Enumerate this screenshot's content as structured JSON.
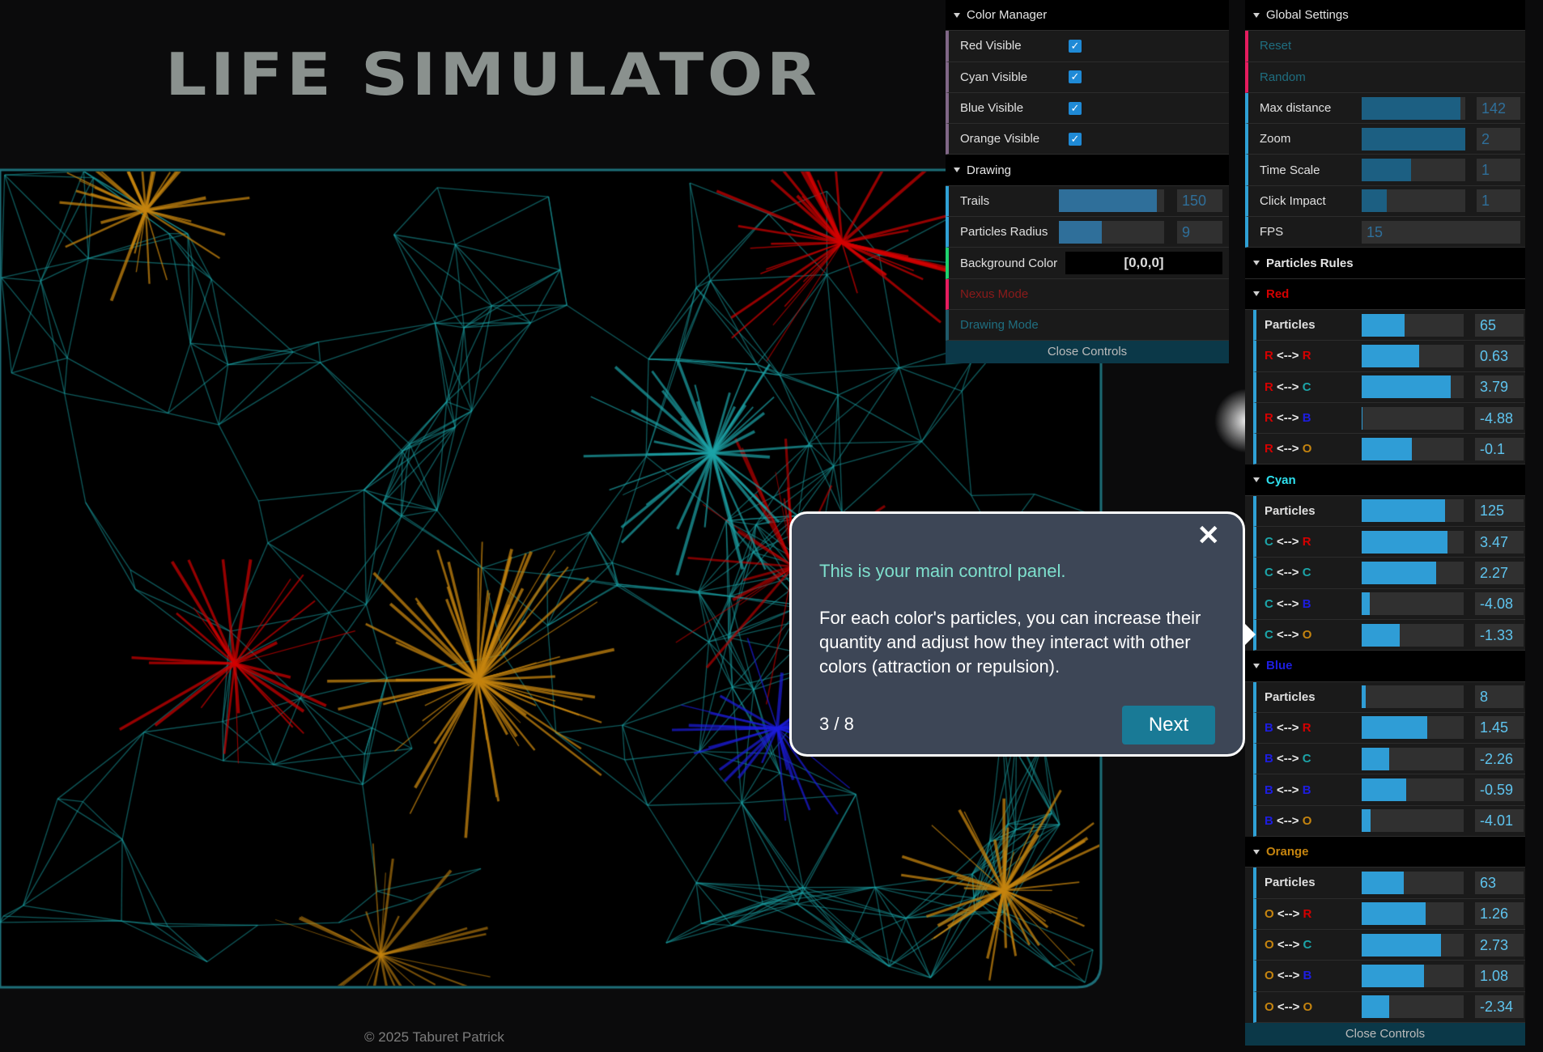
{
  "app": {
    "title": "LIFE SIMULATOR",
    "footer": "© 2025 Taburet Patrick"
  },
  "colors": {
    "red": "#d40000",
    "cyan": "#1ca4a8",
    "blue": "#1d1de0",
    "orange": "#c5840f",
    "slider": "#2f9dd6",
    "accent_teal": "#197a96"
  },
  "color_manager": {
    "title": "Color Manager",
    "items": [
      {
        "label": "Red Visible",
        "checked": true
      },
      {
        "label": "Cyan Visible",
        "checked": true
      },
      {
        "label": "Blue Visible",
        "checked": true
      },
      {
        "label": "Orange Visible",
        "checked": true
      }
    ]
  },
  "drawing": {
    "title": "Drawing",
    "trails": {
      "label": "Trails",
      "value": "150",
      "fill": 0.93
    },
    "radius": {
      "label": "Particles Radius",
      "value": "9",
      "fill": 0.41
    },
    "background_color": {
      "label": "Background Color",
      "value": "[0,0,0]"
    },
    "nexus_mode": "Nexus Mode",
    "drawing_mode": "Drawing Mode",
    "close": "Close Controls"
  },
  "global_settings": {
    "title": "Global Settings",
    "reset": "Reset",
    "random": "Random",
    "max_distance": {
      "label": "Max distance",
      "value": "142",
      "fill": 0.95
    },
    "zoom": {
      "label": "Zoom",
      "value": "2",
      "fill": 1.0
    },
    "time_scale": {
      "label": "Time Scale",
      "value": "1",
      "fill": 0.48
    },
    "click_impact": {
      "label": "Click Impact",
      "value": "1",
      "fill": 0.24
    },
    "fps": {
      "label": "FPS",
      "value": "15"
    }
  },
  "particles_rules": {
    "title": "Particles Rules",
    "groups": [
      {
        "name": "Red",
        "short": "R",
        "rows": [
          {
            "label": "Particles",
            "value": "65",
            "fill": 0.42
          },
          {
            "a": "R",
            "b": "R",
            "value": "0.63",
            "fill": 0.56
          },
          {
            "a": "R",
            "b": "C",
            "value": "3.79",
            "fill": 0.87
          },
          {
            "a": "R",
            "b": "B",
            "value": "-4.88",
            "fill": 0.01
          },
          {
            "a": "R",
            "b": "O",
            "value": "-0.1",
            "fill": 0.49
          }
        ]
      },
      {
        "name": "Cyan",
        "short": "C",
        "rows": [
          {
            "label": "Particles",
            "value": "125",
            "fill": 0.82
          },
          {
            "a": "C",
            "b": "R",
            "value": "3.47",
            "fill": 0.84
          },
          {
            "a": "C",
            "b": "C",
            "value": "2.27",
            "fill": 0.73
          },
          {
            "a": "C",
            "b": "B",
            "value": "-4.08",
            "fill": 0.08
          },
          {
            "a": "C",
            "b": "O",
            "value": "-1.33",
            "fill": 0.37
          }
        ]
      },
      {
        "name": "Blue",
        "short": "B",
        "rows": [
          {
            "label": "Particles",
            "value": "8",
            "fill": 0.04
          },
          {
            "a": "B",
            "b": "R",
            "value": "1.45",
            "fill": 0.64
          },
          {
            "a": "B",
            "b": "C",
            "value": "-2.26",
            "fill": 0.27
          },
          {
            "a": "B",
            "b": "B",
            "value": "-0.59",
            "fill": 0.44
          },
          {
            "a": "B",
            "b": "O",
            "value": "-4.01",
            "fill": 0.09
          }
        ]
      },
      {
        "name": "Orange",
        "short": "O",
        "rows": [
          {
            "label": "Particles",
            "value": "63",
            "fill": 0.41
          },
          {
            "a": "O",
            "b": "R",
            "value": "1.26",
            "fill": 0.63
          },
          {
            "a": "O",
            "b": "C",
            "value": "2.73",
            "fill": 0.78
          },
          {
            "a": "O",
            "b": "B",
            "value": "1.08",
            "fill": 0.61
          },
          {
            "a": "O",
            "b": "O",
            "value": "-2.34",
            "fill": 0.27
          }
        ]
      }
    ],
    "close": "Close Controls"
  },
  "tutorial": {
    "close_icon": "close-icon",
    "heading": "This is your main control panel.",
    "body": "For each color's particles, you can increase their quantity and adjust how they interact with other colors (attraction or repulsion).",
    "counter": "3 / 8",
    "next_label": "Next"
  }
}
